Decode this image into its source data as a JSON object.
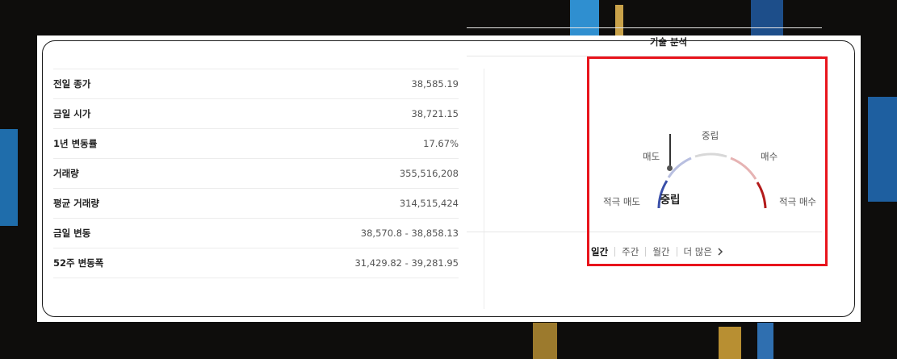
{
  "stats": [
    {
      "label": "전일 종가",
      "value": "38,585.19"
    },
    {
      "label": "금일 시가",
      "value": "38,721.15"
    },
    {
      "label": "1년 변동률",
      "value": "17.67%"
    },
    {
      "label": "거래량",
      "value": "355,516,208"
    },
    {
      "label": "평균 거래량",
      "value": "314,515,424"
    },
    {
      "label": "금일 변동",
      "value": "38,570.8 - 38,858.13"
    },
    {
      "label": "52주 변동폭",
      "value": "31,429.82 - 39,281.95"
    }
  ],
  "technical": {
    "title": "기술 분석",
    "labels": {
      "strong_sell": "적극 매도",
      "sell": "매도",
      "neutral": "중립",
      "buy": "매수",
      "strong_buy": "적극 매수"
    },
    "result": "중립",
    "tabs": [
      "일간",
      "주간",
      "월간"
    ],
    "active_tab": "일간",
    "more": "더 많은"
  },
  "colors": {
    "sell_strong": "#3a4fa8",
    "sell_mid": "#b8bfe0",
    "neutral": "#d8d8d8",
    "buy_mid": "#e6b3b3",
    "buy_strong": "#b31b1b",
    "highlight": "#e8141c"
  }
}
